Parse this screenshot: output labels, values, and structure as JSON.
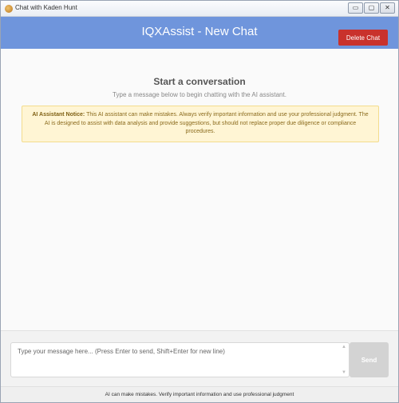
{
  "window": {
    "title": "Chat with Kaden Hunt",
    "app_icon": "app-icon",
    "buttons": {
      "minimize": "▭",
      "maximize": "▢",
      "close": "✕"
    }
  },
  "header": {
    "title": "IQXAssist - New Chat",
    "delete_label": "Delete Chat",
    "accent": "#6f95dc",
    "delete_color": "#c9322c"
  },
  "main": {
    "heading": "Start a conversation",
    "subheading": "Type a message below to begin chatting with the AI assistant.",
    "notice_title": "AI Assistant Notice:",
    "notice_body": "This AI assistant can make mistakes. Always verify important information and use your professional judgment. The AI is designed to assist with data analysis and provide suggestions, but should not replace proper due diligence or compliance procedures."
  },
  "composer": {
    "placeholder": "Type your message here... (Press Enter to send, Shift+Enter for new line)",
    "send_label": "Send"
  },
  "footer": {
    "text": "AI can make mistakes. Verify important information and use professional judgment"
  }
}
